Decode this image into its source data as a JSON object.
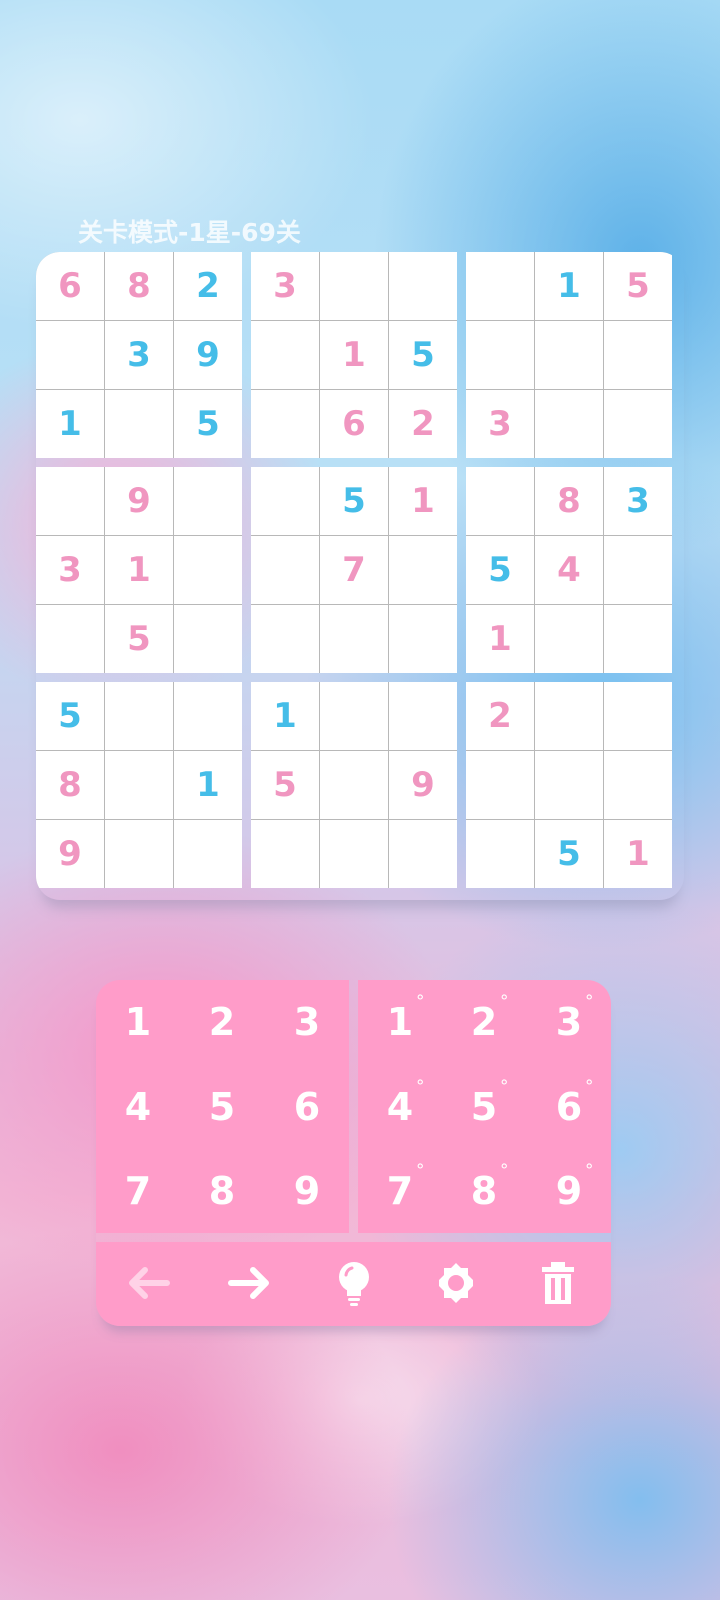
{
  "header": {
    "level_title": "关卡模式-1星-69关"
  },
  "colors": {
    "given_digit": "#f096c0",
    "entered_digit": "#45bde8",
    "keypad_background": "#ff9cc9",
    "cell_background": "#ffffff",
    "grid_line": "#b8b8b8"
  },
  "board": {
    "rows": [
      [
        "6",
        "8",
        "2",
        "3",
        "",
        "",
        "",
        "1",
        "5"
      ],
      [
        "",
        "3",
        "9",
        "",
        "1",
        "5",
        "",
        "",
        ""
      ],
      [
        "1",
        "",
        "5",
        "",
        "6",
        "2",
        "3",
        "",
        ""
      ],
      [
        "",
        "9",
        "",
        "",
        "5",
        "1",
        "",
        "8",
        "3"
      ],
      [
        "3",
        "1",
        "",
        "",
        "7",
        "",
        "5",
        "4",
        ""
      ],
      [
        "",
        "5",
        "",
        "",
        "",
        "",
        "1",
        "",
        ""
      ],
      [
        "5",
        "",
        "",
        "1",
        "",
        "",
        "2",
        "",
        ""
      ],
      [
        "8",
        "",
        "1",
        "5",
        "",
        "9",
        "",
        "",
        ""
      ],
      [
        "9",
        "",
        "",
        "",
        "",
        "",
        "",
        "5",
        "1"
      ]
    ],
    "colors": [
      [
        "p",
        "p",
        "b",
        "p",
        "",
        "",
        "",
        "b",
        "p"
      ],
      [
        "",
        "b",
        "b",
        "",
        "p",
        "b",
        "",
        "",
        ""
      ],
      [
        "b",
        "",
        "b",
        "",
        "p",
        "p",
        "p",
        "",
        ""
      ],
      [
        "",
        "p",
        "",
        "",
        "b",
        "p",
        "",
        "p",
        "b"
      ],
      [
        "p",
        "p",
        "",
        "",
        "p",
        "",
        "b",
        "p",
        ""
      ],
      [
        "",
        "p",
        "",
        "",
        "",
        "",
        "p",
        "",
        ""
      ],
      [
        "b",
        "",
        "",
        "b",
        "",
        "",
        "p",
        "",
        ""
      ],
      [
        "p",
        "",
        "b",
        "p",
        "",
        "p",
        "",
        "",
        ""
      ],
      [
        "p",
        "",
        "",
        "",
        "",
        "",
        "",
        "b",
        "p"
      ]
    ]
  },
  "keypad": {
    "numbers": [
      "1",
      "2",
      "3",
      "4",
      "5",
      "6",
      "7",
      "8",
      "9"
    ],
    "notes": [
      "1",
      "2",
      "3",
      "4",
      "5",
      "6",
      "7",
      "8",
      "9"
    ],
    "note_mark": "°"
  },
  "toolbar": {
    "tools": [
      {
        "name": "undo",
        "icon": "arrow-left-icon",
        "enabled": false
      },
      {
        "name": "redo",
        "icon": "arrow-right-icon",
        "enabled": true
      },
      {
        "name": "hint",
        "icon": "lightbulb-icon",
        "enabled": true
      },
      {
        "name": "settings",
        "icon": "gear-icon",
        "enabled": true
      },
      {
        "name": "erase",
        "icon": "trash-icon",
        "enabled": true
      }
    ]
  }
}
